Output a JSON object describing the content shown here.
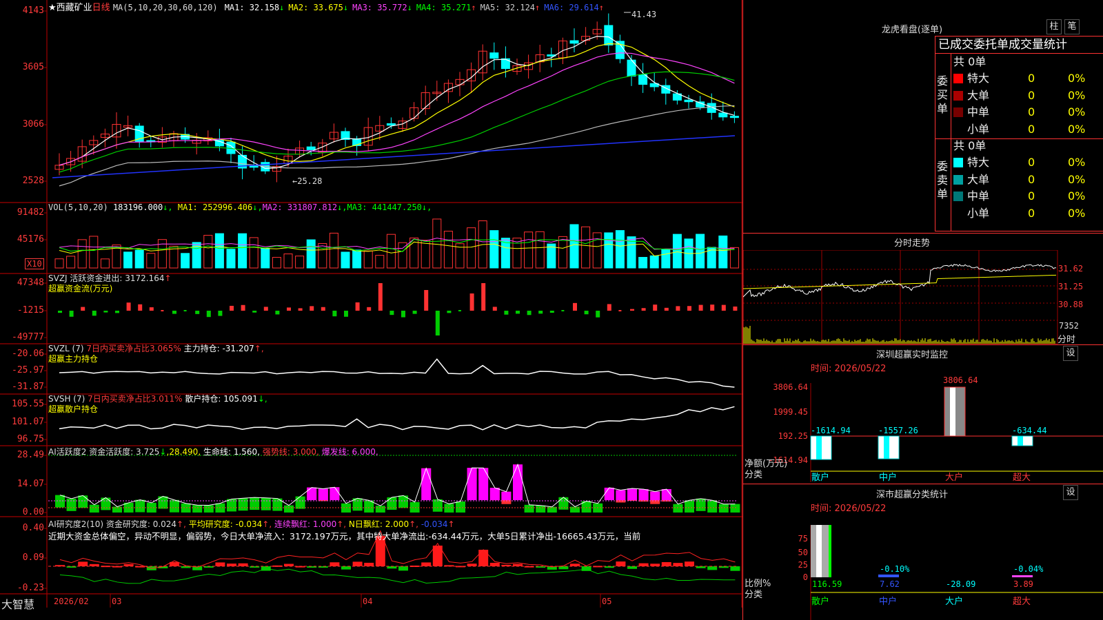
{
  "stock": {
    "name": "西藏矿业",
    "period": "日线",
    "ma_label": "MA(5,10,20,30,60,120)",
    "star": "★",
    "ma_values": [
      {
        "label": "MA1: 32.158",
        "arrow": "↓",
        "color": "#ffffff"
      },
      {
        "label": "MA2: 33.675",
        "arrow": "↓",
        "color": "#ffff00"
      },
      {
        "label": "MA3: 35.772",
        "arrow": "↓",
        "color": "#ff44ff"
      },
      {
        "label": "MA4: 35.271",
        "arrow": "↑",
        "color": "#00ff00"
      },
      {
        "label": "MA5: 32.124",
        "arrow": "↑",
        "color": "#cccccc"
      },
      {
        "label": "MA6: 29.614",
        "arrow": "↑",
        "color": "#3355ff"
      }
    ],
    "y_labels": [
      "4143",
      "3605",
      "3066",
      "2528"
    ],
    "high_mark": "41.43",
    "low_mark": "←25.28"
  },
  "volume": {
    "header": "VOL(5,10,20)",
    "value": "183196.000",
    "ma": [
      {
        "label": "MA1: 252996.406",
        "arrow": "↓",
        "color": "#ffffff"
      },
      {
        "label": "MA2: 331807.812",
        "arrow": "↓",
        "color": "#ff44ff"
      },
      {
        "label": "MA3: 441447.250",
        "arrow": "↓",
        "color": "#00ff00"
      }
    ],
    "y_labels": [
      "91482",
      "45176"
    ],
    "unit": "X10"
  },
  "svzj": {
    "line1": "SVZJ  活跃资金进出: 3172.164",
    "arrow": "↑",
    "line2": "超赢资金流(万元)",
    "y_labels": [
      "47348",
      "-1215",
      "-49777"
    ]
  },
  "svzl": {
    "prefix": "SVZL (7)",
    "red": "7日内买卖净占比3.065%",
    "tail": "主力持仓: -31.207",
    "arrow": "↑,",
    "line2": "超赢主力持仓",
    "y_labels": [
      "-20.06",
      "-25.97",
      "-31.87"
    ]
  },
  "svsh": {
    "prefix": "SVSH (7)",
    "red": "7日内买卖净占比3.011%",
    "tail": "散户持仓: 105.091",
    "arrow": "↓,",
    "line2": "超赢散户持仓",
    "y_labels": [
      "105.55",
      "101.07",
      "96.75"
    ]
  },
  "ai_active": {
    "title": "AI活跃度2 资金活跃度: 3.725",
    "a1": "↓",
    "v2": "28.490",
    "life": "生命线: 1.560,",
    "strong": "强势线: 3.000,",
    "burst": "爆发线: 6.000,",
    "y_labels": [
      "28.49",
      "14.07",
      "0.00"
    ]
  },
  "ai_research": {
    "title": "AI研究度2(10) 资金研究度: 0.024",
    "avg": "平均研究度: -0.034",
    "red1": "连续飘红: 1.000",
    "red2": "N日飘红: 2.000",
    "last": "-0.034",
    "commentary": "近期大资金总体偏空，异动不明显，偏弱势，今日大单净流入：3172.197万元，其中特大单净流出:-634.44万元，大单5日累计净出-16665.43万元，当前",
    "y_labels": [
      "0.40",
      "0.09",
      "-0.23"
    ]
  },
  "bottom_bar": {
    "logo": "大智慧",
    "date": "2026/02",
    "ticks": [
      "03",
      "04",
      "05"
    ]
  },
  "right": {
    "dragon_title": "龙虎看盘(逐单)",
    "btn_col": "柱",
    "btn_pen": "笔",
    "tab": "已成交委托单成交量统计",
    "buy_label": "委买单",
    "sell_label": "委卖单",
    "buy_total": "共 0单",
    "sell_total": "共 0单",
    "buy_rows": [
      {
        "label": "特大",
        "count": "0",
        "pct": "0%",
        "color": "#ff0000"
      },
      {
        "label": "大单",
        "count": "0",
        "pct": "0%",
        "color": "#aa0000"
      },
      {
        "label": "中单",
        "count": "0",
        "pct": "0%",
        "color": "#770000"
      },
      {
        "label": "小单",
        "count": "0",
        "pct": "0%",
        "color": ""
      }
    ],
    "sell_rows": [
      {
        "label": "特大",
        "count": "0",
        "pct": "0%",
        "color": "#00ffff"
      },
      {
        "label": "大单",
        "count": "0",
        "pct": "0%",
        "color": "#00a0a0"
      },
      {
        "label": "中单",
        "count": "0",
        "pct": "0%",
        "color": "#007777"
      },
      {
        "label": "小单",
        "count": "0",
        "pct": "0%",
        "color": ""
      }
    ],
    "intraday_title": "分时走势",
    "intraday_y": [
      "31.62",
      "31.25",
      "30.88"
    ],
    "intraday_vol": "7352",
    "intraday_label": "分时",
    "monitor_title": "深圳超赢实时监控",
    "monitor_btn": "设",
    "monitor_time": "时间: 2026/05/22",
    "monitor_y": [
      "3806.64",
      "1999.45",
      "192.25",
      "-1614.94"
    ],
    "monitor_unit1": "净额(万元)",
    "monitor_unit2": "分类",
    "monitor_cats": [
      "散户",
      "中户",
      "大户",
      "超大"
    ],
    "monitor_values": [
      "-1614.94",
      "-1557.26",
      "3806.64",
      "-634.44"
    ],
    "stat_title": "深市超赢分类统计",
    "stat_btn": "设",
    "stat_time": "时间: 2026/05/22",
    "stat_y": [
      "75",
      "50",
      "25",
      "0"
    ],
    "stat_unit1": "比例%",
    "stat_unit2": "分类",
    "stat_cats": [
      "散户",
      "中户",
      "大户",
      "超大"
    ],
    "stat_values": [
      "116.59",
      "7.62",
      "-28.09",
      "3.89"
    ],
    "stat_top": [
      "-0.10%",
      "-0.04%"
    ]
  },
  "colors": {
    "up": "#ff3232",
    "down": "#00ffff",
    "grid": "#a00000",
    "axis_text": "#ff3b3b"
  }
}
